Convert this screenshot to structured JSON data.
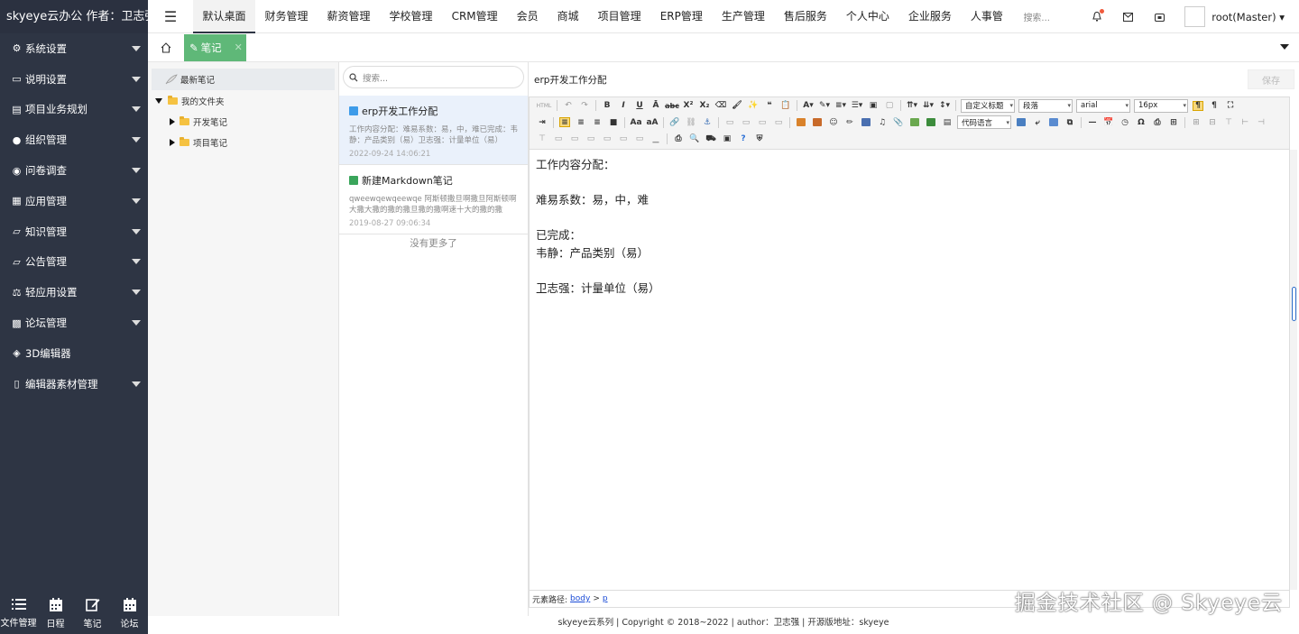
{
  "sidebar": {
    "title": "skyeye云办公 作者：卫志强",
    "items": [
      {
        "label": "系统设置",
        "icon": "gear-icon"
      },
      {
        "label": "说明设置",
        "icon": "monitor-icon"
      },
      {
        "label": "项目业务规划",
        "icon": "list-icon"
      },
      {
        "label": "组织管理",
        "icon": "circle-icon"
      },
      {
        "label": "问卷调查",
        "icon": "chat-icon"
      },
      {
        "label": "应用管理",
        "icon": "grid-icon"
      },
      {
        "label": "知识管理",
        "icon": "folder-icon"
      },
      {
        "label": "公告管理",
        "icon": "folder-icon"
      },
      {
        "label": "轻应用设置",
        "icon": "balance-icon"
      },
      {
        "label": "论坛管理",
        "icon": "qrcode-icon"
      },
      {
        "label": "3D编辑器",
        "icon": "cube-icon"
      },
      {
        "label": "编辑器素材管理",
        "icon": "file-icon"
      }
    ],
    "bottom": [
      {
        "label": "文件管理",
        "icon": "list-icon"
      },
      {
        "label": "日程",
        "icon": "calendar-icon"
      },
      {
        "label": "笔记",
        "icon": "edit-icon"
      },
      {
        "label": "论坛",
        "icon": "calendar-icon"
      }
    ]
  },
  "topnav": {
    "items": [
      "默认桌面",
      "财务管理",
      "薪资管理",
      "学校管理",
      "CRM管理",
      "会员",
      "商城",
      "项目管理",
      "ERP管理",
      "生产管理",
      "售后服务",
      "个人中心",
      "企业服务",
      "人事管"
    ],
    "active_index": 0,
    "search_placeholder": "搜索...",
    "username": "root(Master)"
  },
  "tabbar": {
    "tab_label": "笔记",
    "close_glyph": "✕"
  },
  "tree": {
    "latest": "最新笔记",
    "root": "我的文件夹",
    "children": [
      "开发笔记",
      "项目笔记"
    ]
  },
  "notelist": {
    "search_placeholder": "搜索...",
    "notes": [
      {
        "title": "erp开发工作分配",
        "body": "工作内容分配：难易系数：易，中，难已完成：韦静：产品类别（易）卫志强：计量单位（易）",
        "date": "2022-09-24 14:06:21"
      },
      {
        "title": "新建Markdown笔记",
        "body": "qweewqewqeewqe 阿斯顿撒旦啊撒旦阿斯顿啊大撒大撒的撒的撒旦撒的撒啊速十大的撒的撒",
        "date": "2019-08-27 09:06:34"
      }
    ],
    "no_more": "没有更多了"
  },
  "editor": {
    "title": "erp开发工作分配",
    "save_label": "保存",
    "toolbar": {
      "heading_select": "自定义标题",
      "paragraph_select": "段落",
      "font_select": "arial",
      "size_select": "16px",
      "code_select": "代码语言",
      "html_label": "HTML"
    },
    "content": [
      "工作内容分配：",
      "",
      "难易系数：易，中，难",
      "",
      "已完成：",
      "韦静：产品类别（易）",
      "",
      "卫志强：计量单位（易）"
    ],
    "path_label": "元素路径:",
    "path_body": "body",
    "path_sep": ">",
    "path_p": "p",
    "watermark": "掘金技术社区 @ Skyeye云"
  },
  "footer": {
    "text": "skyeye云系列 | Copyright © 2018~2022 | author：卫志强 | 开源版地址：skyeye"
  },
  "colors": {
    "sidebar_bg": "#2e3544",
    "tab_green": "#5fb878",
    "selected_note": "#eaf1fb",
    "notify_dot": "#f05a3c"
  }
}
